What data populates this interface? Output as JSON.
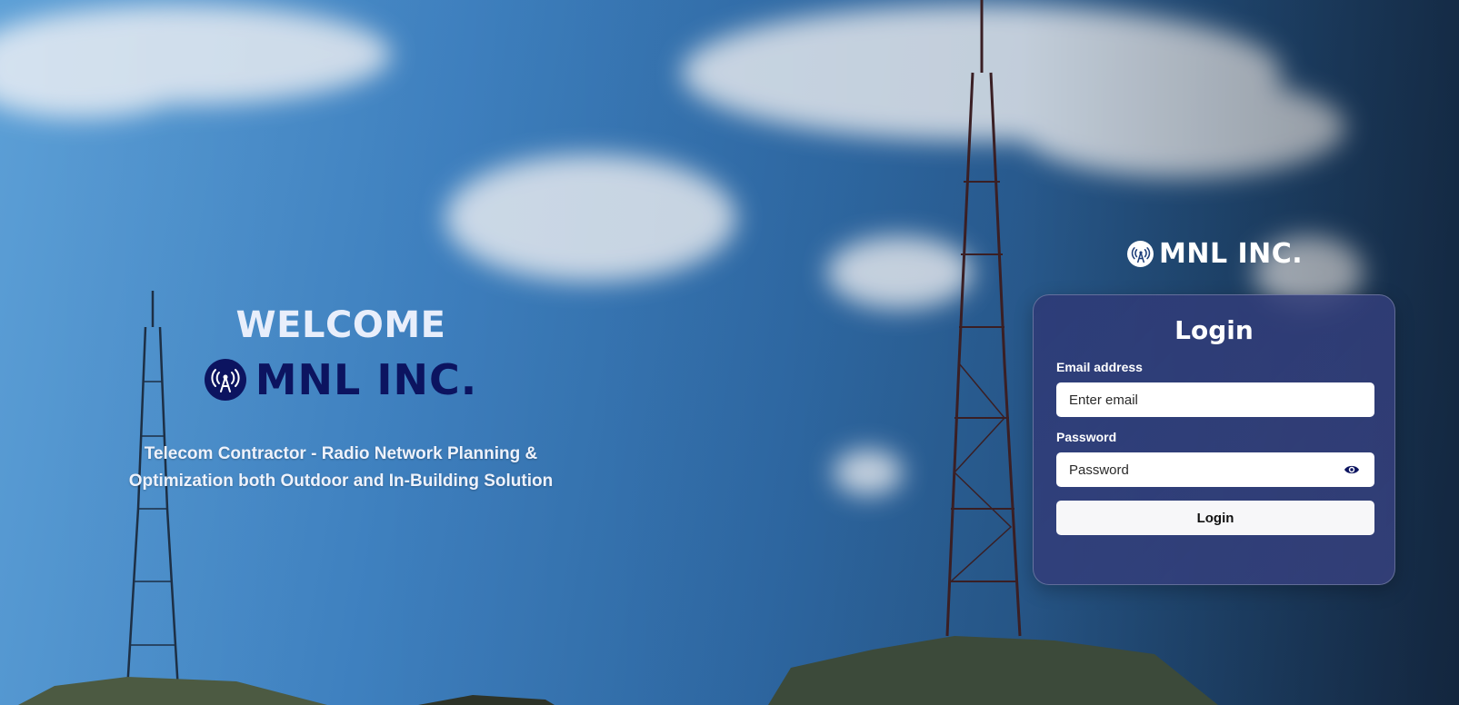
{
  "hero": {
    "welcome": "WELCOME",
    "brand_name": "MNL INC.",
    "tagline_line1": "Telecom Contractor - Radio Network Planning &",
    "tagline_line2": "Optimization both Outdoor and In-Building Solution"
  },
  "header": {
    "brand_name": "MNL INC."
  },
  "login": {
    "title": "Login",
    "email_label": "Email address",
    "email_placeholder": "Enter email",
    "password_label": "Password",
    "password_placeholder": "Password",
    "submit_label": "Login"
  },
  "icons": {
    "brand_logo": "radio-tower-icon",
    "password_toggle": "eye-icon"
  },
  "colors": {
    "brand_navy": "#0c1460",
    "card_bg": "#2e3a76",
    "sky_light": "#5c9fd6",
    "sky_dark": "#1d3a5f"
  }
}
